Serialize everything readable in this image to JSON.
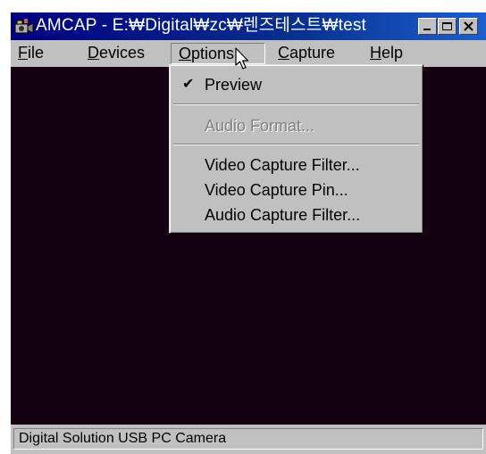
{
  "window": {
    "title": "AMCAP - E:₩Digital₩zc₩렌즈테스트₩test",
    "app_icon": "camera-app-icon",
    "controls": [
      "minimize-icon",
      "maximize-icon",
      "close-icon"
    ]
  },
  "menubar": {
    "items": [
      {
        "label": "File",
        "underline": "F"
      },
      {
        "label": "Devices",
        "underline": "D"
      },
      {
        "label": "Options",
        "underline": "O"
      },
      {
        "label": "Capture",
        "underline": "C"
      },
      {
        "label": "Help",
        "underline": "H"
      }
    ],
    "open_menu": "Options"
  },
  "options_menu": {
    "items": [
      {
        "label": "Preview",
        "checked": true,
        "enabled": true
      },
      {
        "label": "Audio Format...",
        "enabled": false
      },
      {
        "label": "Video Capture Filter...",
        "enabled": true
      },
      {
        "label": "Video Capture Pin...",
        "enabled": true
      },
      {
        "label": "Audio Capture Filter...",
        "enabled": true
      }
    ]
  },
  "video": {
    "background": "#130010"
  },
  "statusbar": {
    "text": "Digital Solution USB PC Camera"
  },
  "colors": {
    "title_active": "#000080",
    "face": "#c0c0c0",
    "disabled_text": "#808080"
  }
}
